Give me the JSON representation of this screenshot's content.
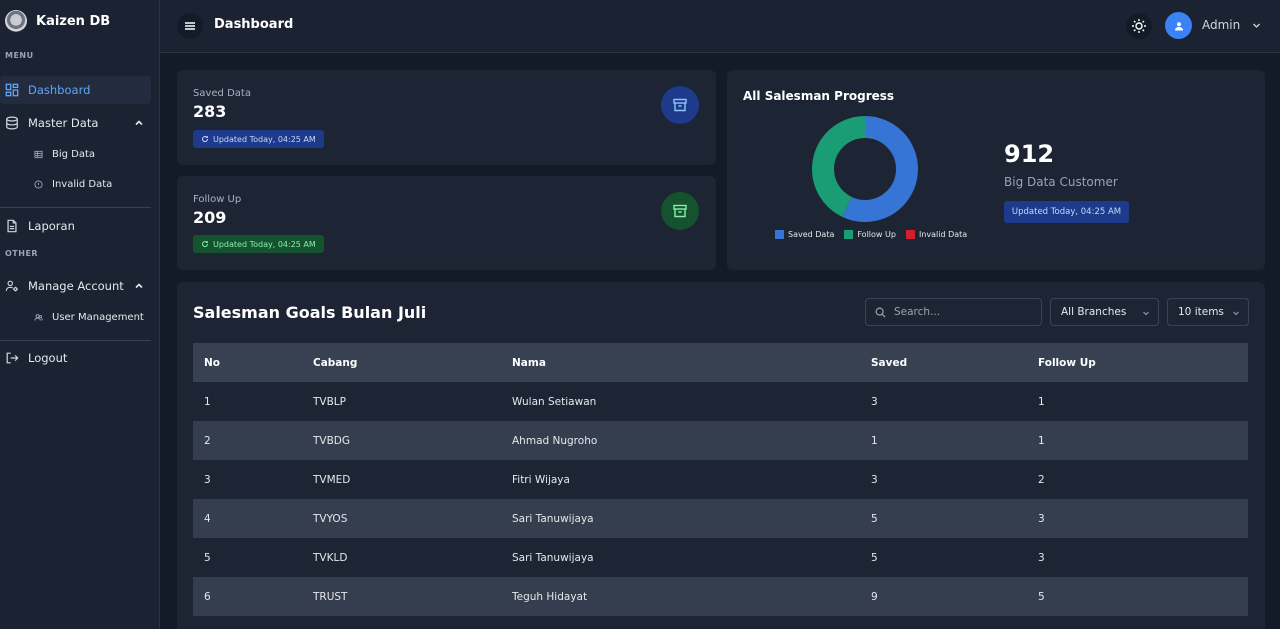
{
  "sidebar": {
    "brand": "Kaizen DB",
    "menu_label": "MENU",
    "other_label": "OTHER",
    "dashboard": "Dashboard",
    "master_data": "Master Data",
    "big_data": "Big Data",
    "invalid_data": "Invalid Data",
    "laporan": "Laporan",
    "manage_account": "Manage Account",
    "user_management": "User Management",
    "logout": "Logout"
  },
  "topbar": {
    "title": "Dashboard",
    "user": "Admin"
  },
  "stats": {
    "saved": {
      "label": "Saved Data",
      "value": "283",
      "updated": "Updated Today, 04:25 AM"
    },
    "follow": {
      "label": "Follow Up",
      "value": "209",
      "updated": "Updated Today, 04:25 AM"
    }
  },
  "progress": {
    "title": "All Salesman Progress",
    "total": "912",
    "total_label": "Big Data Customer",
    "updated": "Updated Today, 04:25 AM",
    "legend": [
      "Saved Data",
      "Follow Up",
      "Invalid Data"
    ],
    "colors": {
      "saved": "#3674d6",
      "follow": "#1a9d74",
      "invalid": "#d21f2b"
    },
    "segments": {
      "saved": 57,
      "follow": 43,
      "invalid": 0
    }
  },
  "goals": {
    "title": "Salesman Goals Bulan Juli",
    "search_placeholder": "Search...",
    "branch_filter": "All Branches",
    "items_filter": "10 items",
    "columns": [
      "No",
      "Cabang",
      "Nama",
      "Saved",
      "Follow Up"
    ],
    "rows": [
      [
        "1",
        "TVBLP",
        "Wulan Setiawan",
        "3",
        "1"
      ],
      [
        "2",
        "TVBDG",
        "Ahmad Nugroho",
        "1",
        "1"
      ],
      [
        "3",
        "TVMED",
        "Fitri Wijaya",
        "3",
        "2"
      ],
      [
        "4",
        "TVYOS",
        "Sari Tanuwijaya",
        "5",
        "3"
      ],
      [
        "5",
        "TVKLD",
        "Sari Tanuwijaya",
        "5",
        "3"
      ],
      [
        "6",
        "TRUST",
        "Teguh Hidayat",
        "9",
        "5"
      ]
    ]
  }
}
